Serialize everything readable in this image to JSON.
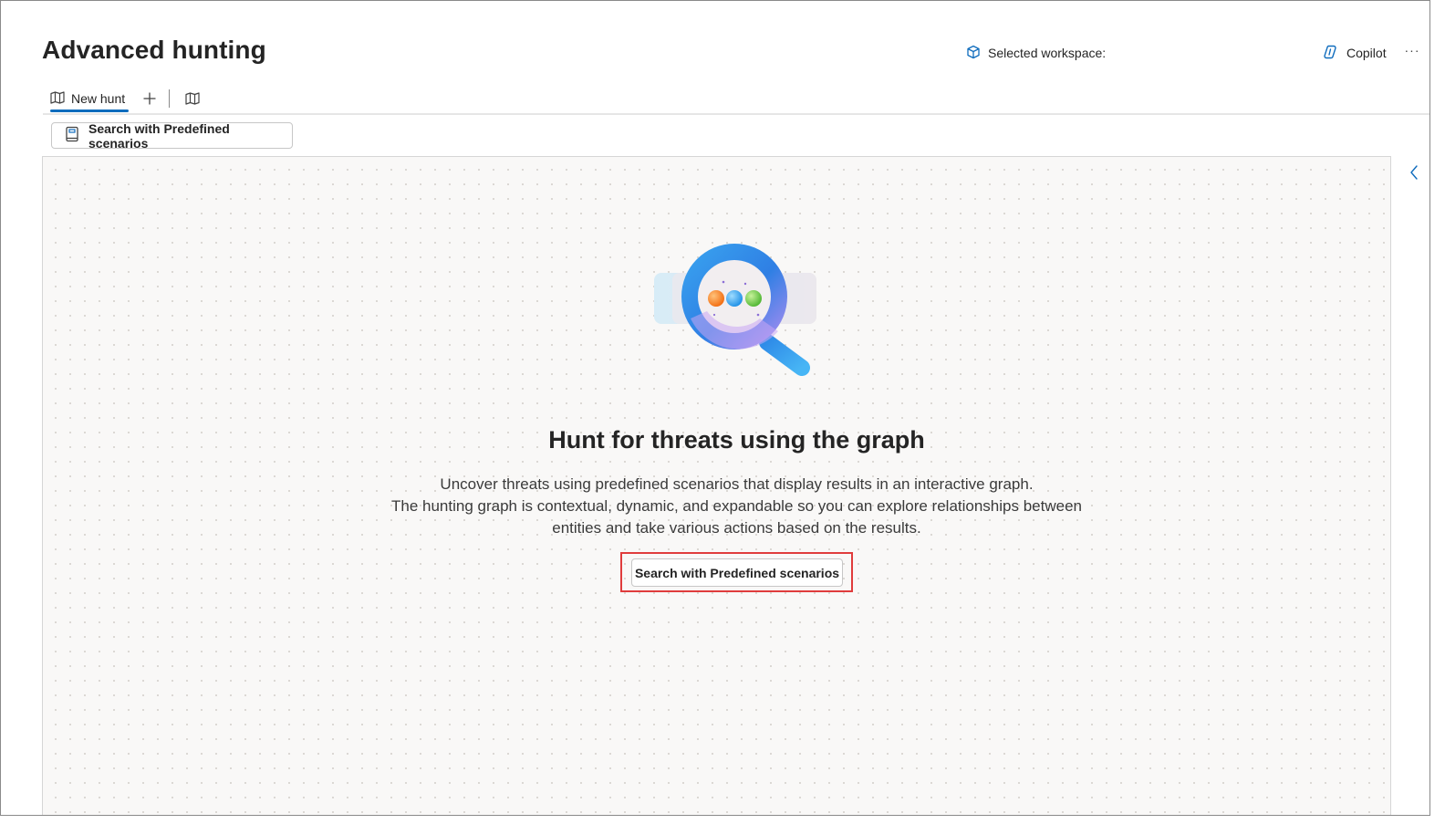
{
  "header": {
    "title": "Advanced hunting",
    "workspace_label": "Selected workspace:",
    "workspace_icon": "cube-icon",
    "copilot_label": "Copilot",
    "copilot_icon": "copilot-icon",
    "more_label": "···"
  },
  "tabs": {
    "items": [
      {
        "label": "New hunt",
        "icon": "map-icon",
        "active": true
      }
    ],
    "add_icon": "plus-icon",
    "map_icon": "map-icon"
  },
  "toolbar": {
    "predefined_label": "Search with Predefined scenarios",
    "predefined_icon": "book-icon"
  },
  "empty_state": {
    "illustration": "magnifier-graph-illustration",
    "title": "Hunt for threats using the graph",
    "description_lines": [
      "Uncover threats using predefined scenarios that display results in an interactive graph.",
      "The hunting graph is contextual, dynamic, and expandable so you can explore relationships between",
      "entities and take various actions based on the results."
    ],
    "cta_label": "Search with Predefined scenarios"
  },
  "colors": {
    "accent": "#0f6cbd",
    "highlight_border": "#e03c3c",
    "canvas_background": "#f9f8f7"
  }
}
